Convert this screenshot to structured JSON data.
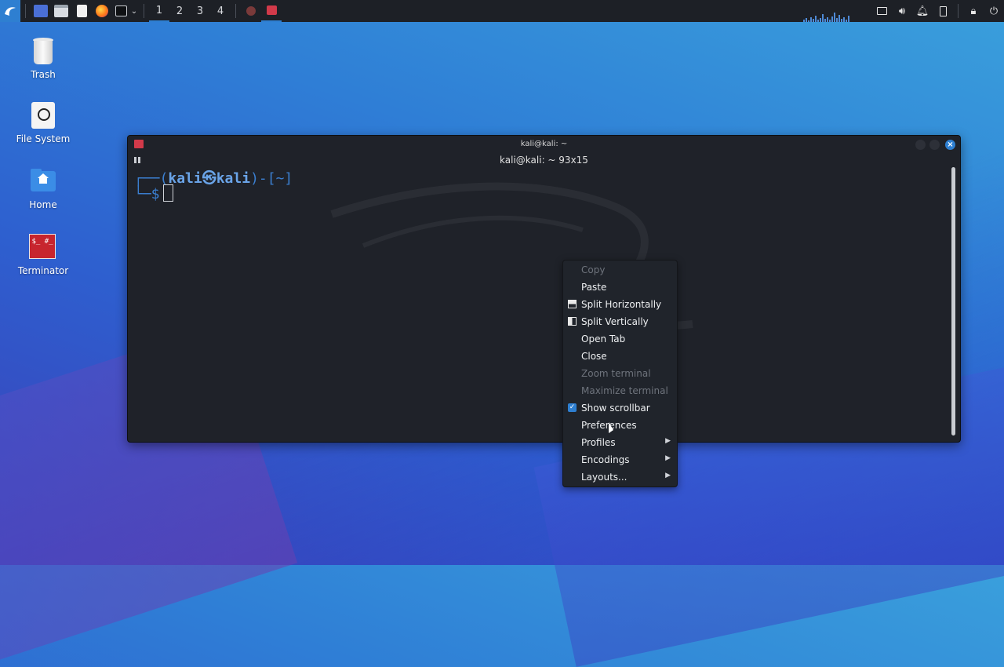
{
  "taskbar": {
    "workspaces": [
      "1",
      "2",
      "3",
      "4"
    ],
    "active_workspace": "1",
    "accent": "#2e7fd1"
  },
  "desktop": {
    "items": [
      {
        "label": "Trash",
        "icon": "trash-icon"
      },
      {
        "label": "File System",
        "icon": "drive-icon"
      },
      {
        "label": "Home",
        "icon": "home-folder-icon"
      },
      {
        "label": "Terminator",
        "icon": "terminator-icon"
      }
    ]
  },
  "window": {
    "title": "kali@kali: ~",
    "header": "kali@kali: ~ 93x15",
    "prompt": {
      "line1_open": "┌──(",
      "user": "kali㉿kali",
      "line1_close": ")-[~]",
      "line2": "└─$"
    }
  },
  "context_menu": {
    "items": [
      {
        "label": "Copy",
        "enabled": false
      },
      {
        "label": "Paste",
        "enabled": true
      },
      {
        "label": "Split Horizontally",
        "enabled": true,
        "icon": "split-horizontal-icon"
      },
      {
        "label": "Split Vertically",
        "enabled": true,
        "icon": "split-vertical-icon"
      },
      {
        "label": "Open Tab",
        "enabled": true
      },
      {
        "label": "Close",
        "enabled": true
      },
      {
        "label": "Zoom terminal",
        "enabled": false
      },
      {
        "label": "Maximize terminal",
        "enabled": false
      },
      {
        "label": "Show scrollbar",
        "enabled": true,
        "checked": true
      },
      {
        "label": "Preferences",
        "enabled": true
      },
      {
        "label": "Profiles",
        "enabled": true,
        "submenu": true
      },
      {
        "label": "Encodings",
        "enabled": true,
        "submenu": true
      },
      {
        "label": "Layouts...",
        "enabled": true,
        "submenu": true
      }
    ]
  }
}
